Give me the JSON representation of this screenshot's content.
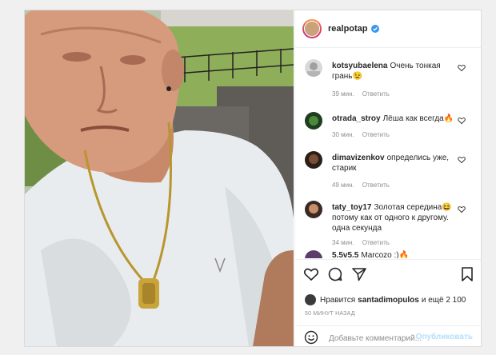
{
  "post": {
    "username": "realpotap",
    "comments": [
      {
        "user": "kotsyubaelena",
        "text": "Очень тонкая грань😉",
        "time": "39 мин.",
        "reply": "Ответить"
      },
      {
        "user": "otrada_stroy",
        "text": "Лёша как всегда🔥",
        "time": "30 мин.",
        "reply": "Ответить"
      },
      {
        "user": "dimavizenkov",
        "text": "определись уже, старик",
        "time": "49 мин.",
        "reply": "Ответить"
      },
      {
        "user": "taty_toy17",
        "text": "Золотая середина😆 потому как от одного к другому. одна секунда",
        "time": "34 мин.",
        "reply": "Ответить"
      },
      {
        "user": "5.5v5.5",
        "text": "Marcozo :)🔥",
        "time": "",
        "reply": ""
      }
    ],
    "likes": {
      "prefix": "Нравится",
      "user": "santadimopulos",
      "suffix": "и ещё 2 100"
    },
    "time_ago": "50 МИНУТ НАЗАД",
    "comment_placeholder": "Добавьте комментарий...",
    "publish_label": "Опубликовать"
  },
  "icons": {
    "like": "heart-icon",
    "comment": "comment-icon",
    "share": "paper-plane-icon",
    "save": "bookmark-icon",
    "emoji": "smiley-icon",
    "verified": "verified-badge-icon"
  },
  "colors": {
    "accent": "#0095f6",
    "publish_disabled": "#b2dffc",
    "verified": "#3897f0"
  }
}
